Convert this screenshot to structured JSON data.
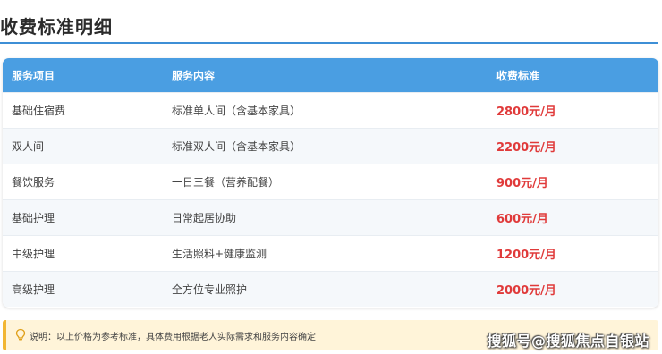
{
  "title": "收费标准明细",
  "table": {
    "headers": [
      "服务项目",
      "服务内容",
      "收费标准"
    ],
    "rows": [
      {
        "item": "基础住宿费",
        "content": "标准单人间（含基本家具）",
        "price": "2800元/月"
      },
      {
        "item": "双人间",
        "content": "标准双人间（含基本家具）",
        "price": "2200元/月"
      },
      {
        "item": "餐饮服务",
        "content": "一日三餐（营养配餐）",
        "price": "900元/月"
      },
      {
        "item": "基础护理",
        "content": "日常起居协助",
        "price": "600元/月"
      },
      {
        "item": "中级护理",
        "content": "生活照料+健康监测",
        "price": "1200元/月"
      },
      {
        "item": "高级护理",
        "content": "全方位专业照护",
        "price": "2000元/月"
      }
    ]
  },
  "note": {
    "icon": "lightbulb-icon",
    "text": "说明：以上价格为参考标准，具体费用根据老人实际需求和服务内容确定"
  },
  "watermark": "搜狐号@搜狐焦点自银站",
  "colors": {
    "accent": "#3e8fd6",
    "header_bg": "#4a9ee2",
    "price": "#e03a3a",
    "note_bg": "#fff4d9",
    "note_border": "#f2b632"
  }
}
